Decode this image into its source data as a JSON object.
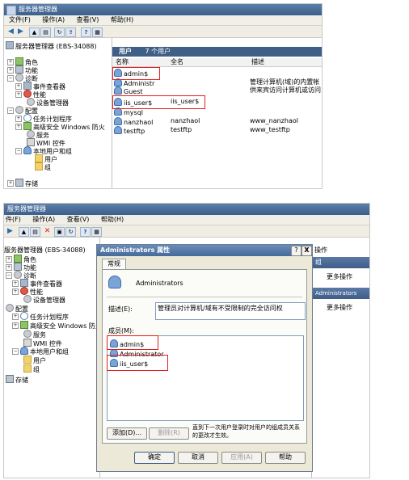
{
  "top": {
    "window_title": "服务器管理器",
    "menu": [
      "文件(F)",
      "操作(A)",
      "查看(V)",
      "帮助(H)"
    ],
    "tree": {
      "root": "服务器管理器 (EBS-34088)",
      "roles": "角色",
      "features": "功能",
      "diagnostics": "诊断",
      "event_viewer": "事件查看器",
      "performance": "性能",
      "device_manager": "设备管理器",
      "config": "配置",
      "task_scheduler": "任务计划程序",
      "firewall": "高级安全 Windows 防火",
      "services": "服务",
      "wmi": "WMI 控件",
      "local_users": "本地用户和组",
      "users": "用户",
      "groups": "组",
      "storage": "存储"
    },
    "pane_title": "用户",
    "pane_count": "7 个用户",
    "columns": [
      "名称",
      "全名",
      "描述"
    ],
    "rows": [
      {
        "name": "admin$",
        "full": "",
        "desc": ""
      },
      {
        "name": "Administr",
        "full": "",
        "desc": "管理计算机(域)的内置帐"
      },
      {
        "name": "Guest",
        "full": "",
        "desc": "供来宾访问计算机或访问"
      },
      {
        "name": "iis_user$",
        "full": "iis_user$",
        "desc": ""
      },
      {
        "name": "mysql",
        "full": "",
        "desc": ""
      },
      {
        "name": "nanzhaol",
        "full": "nanzhaol",
        "desc": "www_nanzhaol"
      },
      {
        "name": "testftp",
        "full": "testftp",
        "desc": "www_testftp"
      }
    ]
  },
  "bottom": {
    "window_title": "服务器管理器",
    "menu": [
      "件(F)",
      "操作(A)",
      "查看(V)",
      "帮助(H)"
    ],
    "tree": {
      "root": "服务器管理器 (EBS-34088)",
      "roles": "角色",
      "features": "功能",
      "diagnostics": "诊断",
      "event_viewer": "事件查看器",
      "performance": "性能",
      "device_manager": "设备管理器",
      "config": "配置",
      "task_scheduler": "任务计划程序",
      "firewall": "高级安全 Windows 防火",
      "services": "服务",
      "wmi": "WMI 控件",
      "local_users": "本地用户和组",
      "users": "用户",
      "groups": "组",
      "storage": "存储"
    },
    "dialog": {
      "title": "Administrators 属性",
      "help_btn": "?",
      "close_btn": "X",
      "tab": "常规",
      "group_name": "Administrators",
      "desc_label": "描述(E):",
      "desc_value": "管理员对计算机/域有不受限制的完全访问权",
      "members_label": "成员(M):",
      "members": [
        "admin$",
        "Administrator",
        "iis_user$"
      ],
      "add_btn": "添加(D)...",
      "remove_btn": "删除(R)",
      "note": "直到下一次用户登录时对用户的组成员关系的更改才生效。",
      "ok": "确定",
      "cancel": "取消",
      "apply": "应用(A)",
      "help": "帮助"
    },
    "actions": {
      "header": "操作",
      "section1": "组",
      "item1": "更多操作",
      "section2": "Administrators",
      "item2": "更多操作"
    }
  }
}
